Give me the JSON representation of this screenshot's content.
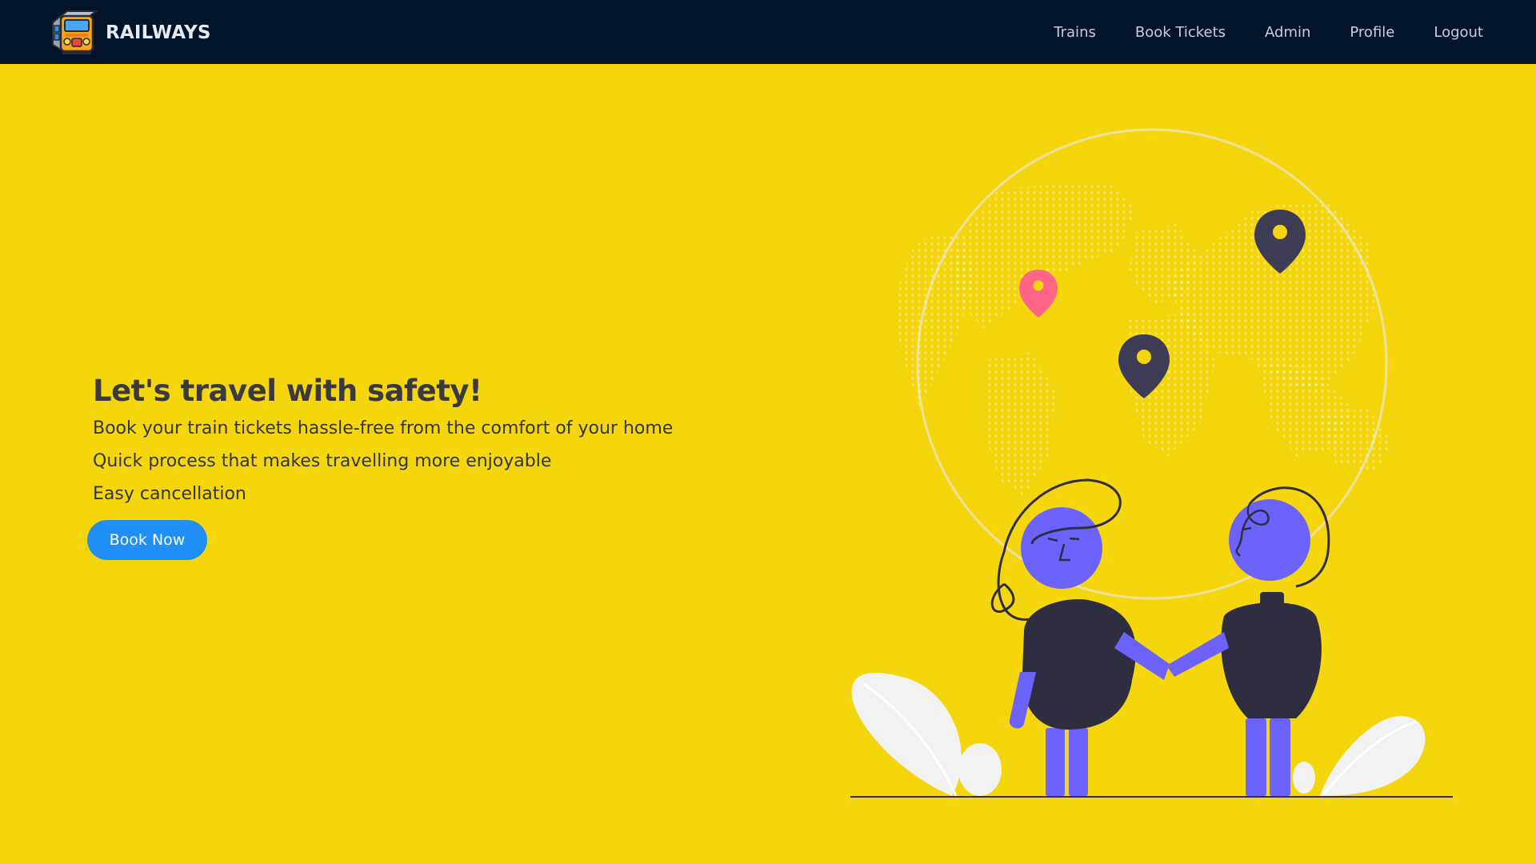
{
  "brand": {
    "name": "RAILWAYS",
    "logo_icon": "train-logo-icon"
  },
  "nav": {
    "links": [
      "Trains",
      "Book Tickets",
      "Admin",
      "Profile",
      "Logout"
    ]
  },
  "hero": {
    "title": "Let's travel with safety!",
    "lines": [
      "Book your train tickets hassle-free from the comfort of your home",
      "Quick process that makes travelling more enjoyable",
      "Easy cancellation"
    ],
    "cta_label": "Book Now"
  },
  "colors": {
    "background": "#f5d60d",
    "navbar": "#021429",
    "accent_button": "#1f8ff5",
    "illustration_people": "#6c63ff",
    "illustration_dark": "#2f2e41",
    "pin_accent": "#ff6584"
  }
}
